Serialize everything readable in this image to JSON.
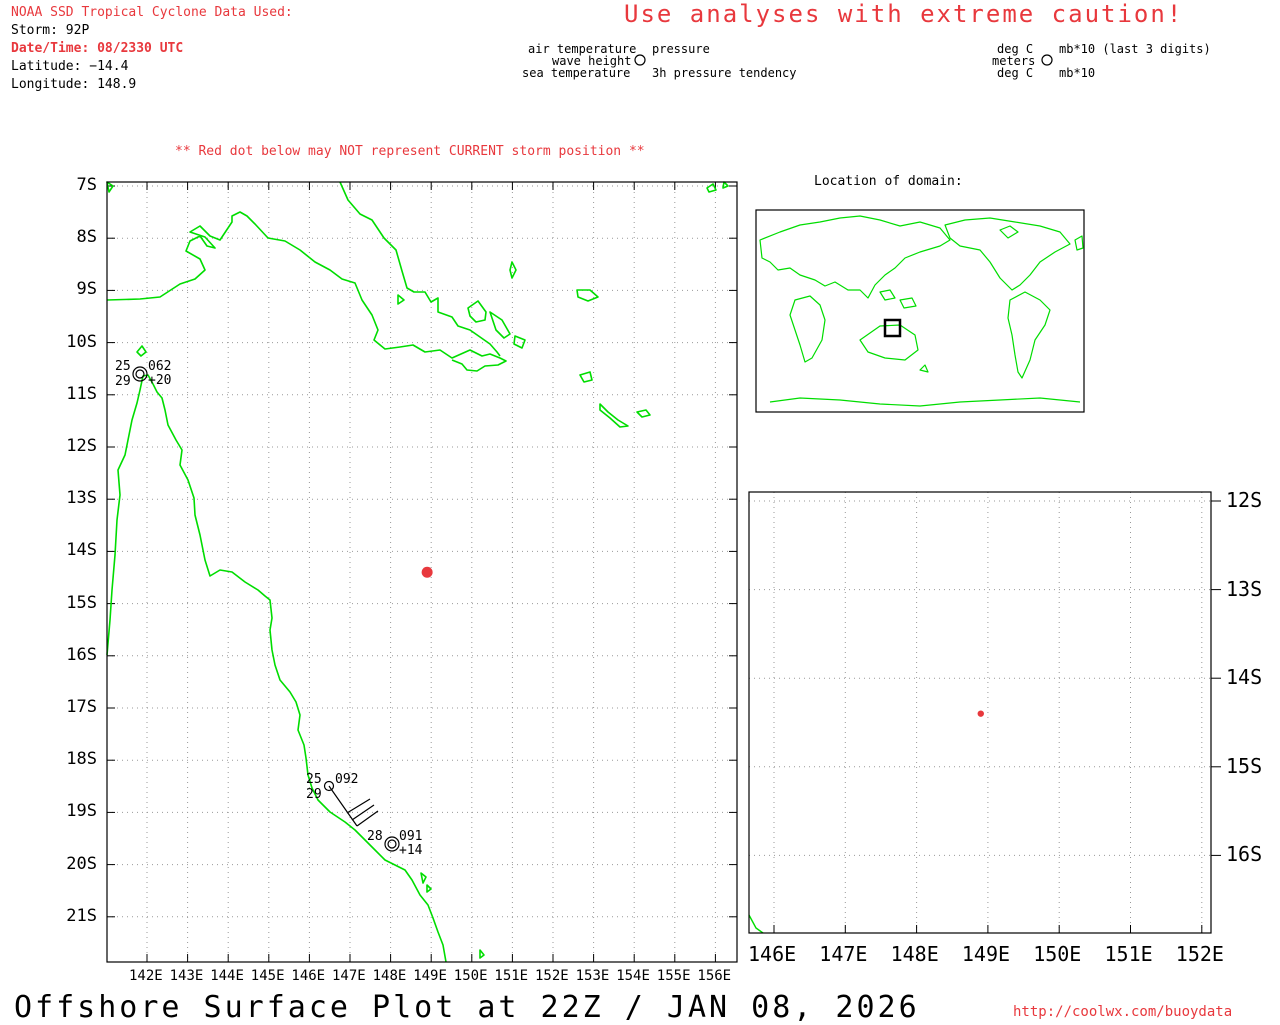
{
  "header": {
    "title": "NOAA SSD Tropical Cyclone Data Used:",
    "storm": "Storm: 92P",
    "datetime": "Date/Time: 08/2330 UTC",
    "latitude": "Latitude: −14.4",
    "longitude": "Longitude: 148.9"
  },
  "caution": "Use analyses with extreme caution!",
  "legend": {
    "air_temperature": "air temperature",
    "wave_height": "wave height",
    "sea_temperature": "sea temperature",
    "pressure": "pressure",
    "pressure_tendency": "3h pressure tendency",
    "unit_air": "deg C",
    "unit_wave": "meters",
    "unit_sea": "deg C",
    "unit_pressure": "mb*10 (last 3 digits)",
    "unit_tendency": "mb*10"
  },
  "note": "** Red dot below may NOT represent CURRENT storm position **",
  "inset_title": "Location of domain:",
  "main_map": {
    "lat_labels": [
      "7S",
      "8S",
      "9S",
      "10S",
      "11S",
      "12S",
      "13S",
      "14S",
      "15S",
      "16S",
      "17S",
      "18S",
      "19S",
      "20S",
      "21S"
    ],
    "lon_labels": [
      "142E",
      "143E",
      "144E",
      "145E",
      "146E",
      "147E",
      "148E",
      "149E",
      "150E",
      "151E",
      "152E",
      "153E",
      "154E",
      "155E",
      "156E"
    ],
    "storm_position": {
      "lat": -14.4,
      "lon": 148.9,
      "color": "#e8383d"
    },
    "coastline_color": "#00dd00",
    "stations": [
      {
        "air": "25",
        "pressure": "062",
        "sea": "29",
        "tendency": "+20",
        "lat": -10.7,
        "lon": 142.2
      },
      {
        "air": "25",
        "pressure": "092",
        "sea": "29",
        "tendency": "",
        "lat": -18.5,
        "lon": 146.7
      },
      {
        "air": "28",
        "pressure": "091",
        "sea": "",
        "tendency": "+14",
        "lat": -19.6,
        "lon": 148.2
      }
    ]
  },
  "zoom_map": {
    "lat_labels": [
      "12S",
      "13S",
      "14S",
      "15S",
      "16S"
    ],
    "lon_labels": [
      "146E",
      "147E",
      "148E",
      "149E",
      "150E",
      "151E",
      "152E"
    ]
  },
  "footer": {
    "title": "Offshore Surface Plot at 22Z / JAN 08, 2026",
    "url": "http://coolwx.com/buoydata"
  }
}
